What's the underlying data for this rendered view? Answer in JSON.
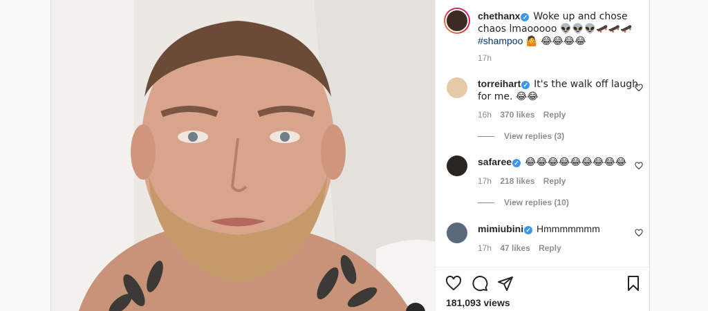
{
  "post": {
    "author": "chethanx",
    "caption": "Woke up and chose chaos lmaooooo 👽👽👽🛹🛹🛹",
    "hashtag": "#shampoo",
    "caption_end": "🤷 😂😂😂😂",
    "time": "17h"
  },
  "comments": [
    {
      "user": "torreihart",
      "text": "It's the walk off laugh for me. 😂😂",
      "time": "16h",
      "likes": "370 likes",
      "reply": "Reply",
      "view_replies": "View replies (3)"
    },
    {
      "user": "safaree",
      "text": "😂😂😂😂😂😂😂😂😂",
      "time": "17h",
      "likes": "218 likes",
      "reply": "Reply",
      "view_replies": "View replies (10)"
    },
    {
      "user": "mimiubini",
      "text": "Hmmmmmmm",
      "time": "17h",
      "likes": "47 likes",
      "reply": "Reply"
    }
  ],
  "views": "181,093 views",
  "icons": {
    "like": "heart-icon",
    "comment": "comment-icon",
    "share": "share-icon",
    "save": "bookmark-icon",
    "verified": "verified-badge-icon"
  },
  "colors": {
    "verified": "#3897f0",
    "muted": "#8e8e8e",
    "text": "#262626"
  }
}
